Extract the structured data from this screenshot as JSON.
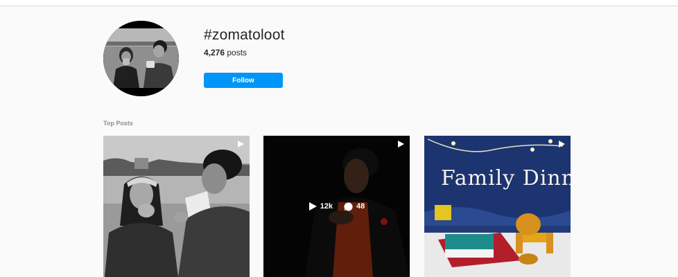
{
  "hashtag": {
    "title": "#zomatoloot",
    "post_count": "4,276",
    "post_count_suffix": "posts",
    "follow_label": "Follow"
  },
  "top_posts": {
    "label": "Top Posts",
    "items": [
      {
        "type": "video",
        "icon": "reel-icon"
      },
      {
        "type": "video",
        "icon": "reel-icon",
        "plays": "12k",
        "comments": "48"
      },
      {
        "type": "video",
        "icon": "reel-icon",
        "overlay_text": "Family Dinn"
      }
    ]
  },
  "colors": {
    "accent": "#0095f6",
    "background": "#fafafa",
    "muted_text": "#8e8e8e"
  }
}
